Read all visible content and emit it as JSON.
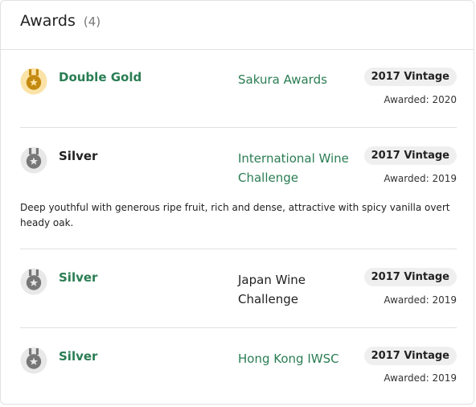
{
  "header": {
    "title": "Awards",
    "count": "(4)"
  },
  "awards": [
    {
      "level": "Double Gold",
      "medal": "gold-medal-icon",
      "competition": "Sakura Awards",
      "vintage": "2017 Vintage",
      "awarded": "Awarded: 2020"
    },
    {
      "level": "Silver",
      "medal": "silver-medal-icon",
      "competition": "International Wine Challenge",
      "vintage": "2017 Vintage",
      "awarded": "Awarded: 2019",
      "note": "Deep youthful with generous ripe fruit, rich and dense, attractive with spicy vanilla overt heady oak."
    },
    {
      "level": "Silver",
      "medal": "silver-medal-icon",
      "competition": "Japan Wine Challenge",
      "vintage": "2017 Vintage",
      "awarded": "Awarded: 2019"
    },
    {
      "level": "Silver",
      "medal": "silver-medal-icon",
      "competition": "Hong Kong IWSC",
      "vintage": "2017 Vintage",
      "awarded": "Awarded: 2019"
    }
  ],
  "colors": {
    "link_green": "#2a7d53",
    "gold": "#d9a21b",
    "silver": "#7b7b7b",
    "badge_bg": "#efefef"
  }
}
